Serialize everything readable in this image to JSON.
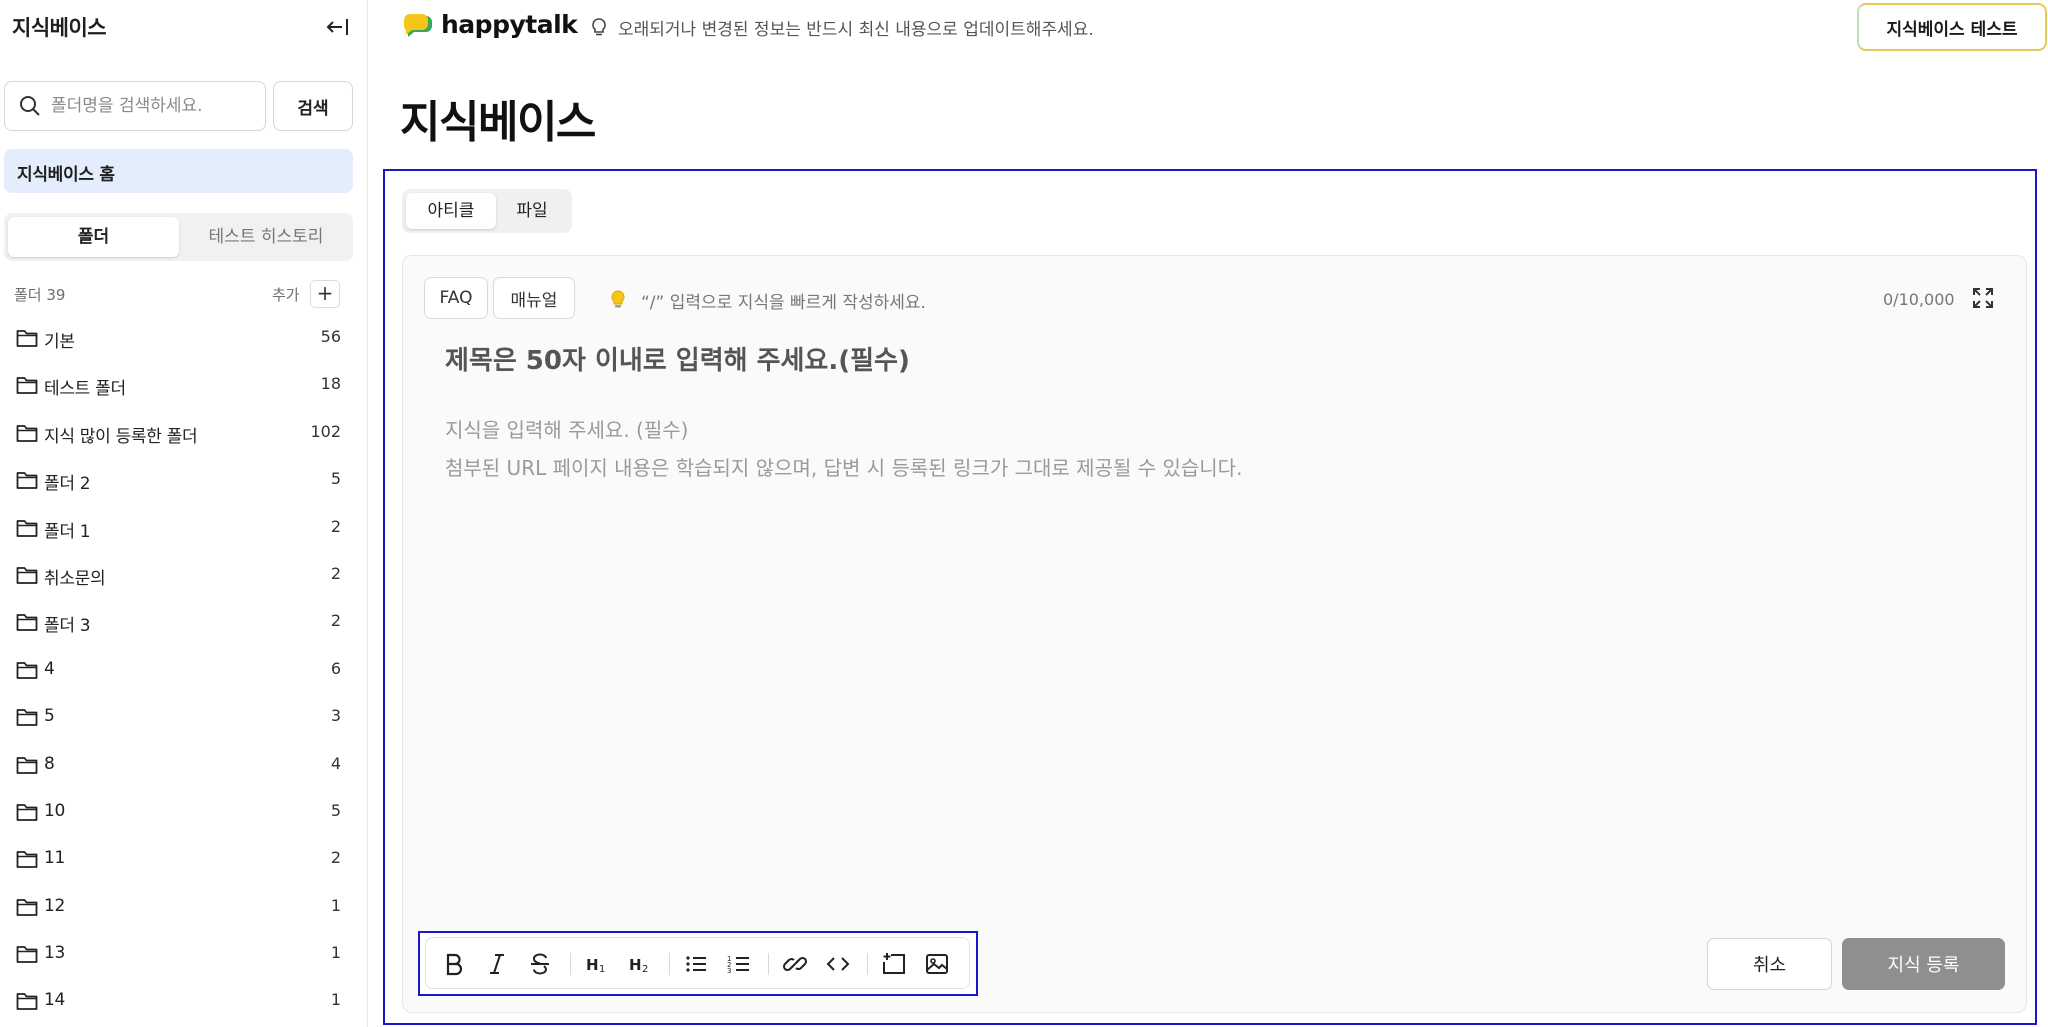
{
  "sidebar": {
    "title": "지식베이스",
    "search_placeholder": "폴더명을 검색하세요.",
    "search_button": "검색",
    "home_label": "지식베이스 홈",
    "tabs": [
      "폴더",
      "테스트 히스토리"
    ],
    "folder_count_label": "폴더 39",
    "add_label": "추가",
    "add_icon": "+",
    "folders": [
      {
        "name": "기본",
        "count": "56"
      },
      {
        "name": "테스트 폴더",
        "count": "18"
      },
      {
        "name": "지식 많이 등록한 폴더",
        "count": "102"
      },
      {
        "name": "폴더 2",
        "count": "5"
      },
      {
        "name": "폴더 1",
        "count": "2"
      },
      {
        "name": "취소문의",
        "count": "2"
      },
      {
        "name": "폴더 3",
        "count": "2"
      },
      {
        "name": "4",
        "count": "6"
      },
      {
        "name": "5",
        "count": "3"
      },
      {
        "name": "8",
        "count": "4"
      },
      {
        "name": "10",
        "count": "5"
      },
      {
        "name": "11",
        "count": "2"
      },
      {
        "name": "12",
        "count": "1"
      },
      {
        "name": "13",
        "count": "1"
      },
      {
        "name": "14",
        "count": "1"
      }
    ]
  },
  "header": {
    "brand": "happytalk",
    "notice": "오래되거나 변경된 정보는 반드시 최신 내용으로 업데이트해주세요.",
    "test_button": "지식베이스 테스트"
  },
  "main": {
    "page_title": "지식베이스",
    "type_tabs": [
      "아티클",
      "파일"
    ],
    "editor": {
      "chips": [
        "FAQ",
        "매뉴얼"
      ],
      "hint": "“/” 입력으로 지식을 빠르게 작성하세요.",
      "counter": "0/10,000",
      "title_placeholder": "제목은 50자 이내로 입력해 주세요.(필수)",
      "body_placeholder_line1": "지식을 입력해 주세요. (필수)",
      "body_placeholder_line2": "첨부된 URL 페이지 내용은 학습되지 않으며, 답변 시 등록된 링크가 그대로 제공될 수 있습니다.",
      "cancel_button": "취소",
      "submit_button": "지식 등록"
    }
  },
  "colors": {
    "accent_blue": "#1a17c8",
    "home_bg": "#e3edfb",
    "submit_bg": "#8f8f8f",
    "logo_yellow": "#f5c518",
    "logo_green": "#3aa55b"
  },
  "icons": {
    "collapse": "collapse-left-icon",
    "search": "search-icon",
    "folder": "folder-icon",
    "bulb": "lightbulb-icon",
    "expand": "expand-icon",
    "toolbar": [
      "bold-icon",
      "italic-icon",
      "strikethrough-icon",
      "heading1-icon",
      "heading2-icon",
      "bullet-list-icon",
      "numbered-list-icon",
      "link-icon",
      "code-icon",
      "embed-icon",
      "image-icon"
    ]
  }
}
